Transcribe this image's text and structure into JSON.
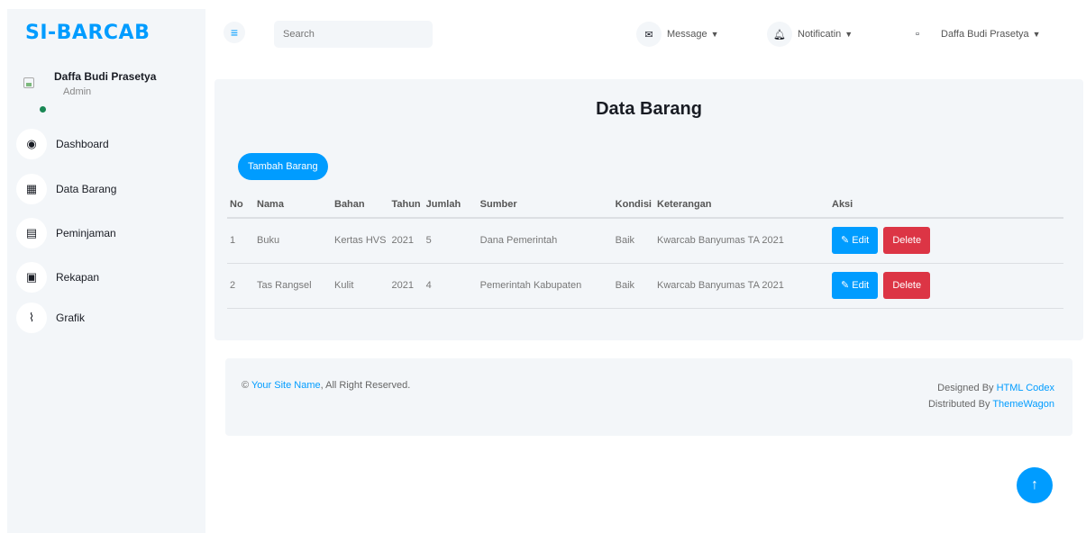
{
  "sidebar": {
    "brand": "SI-BARCAB",
    "profile": {
      "name": "Daffa Budi Prasetya",
      "role": "Admin"
    },
    "items": [
      {
        "label": "Dashboard",
        "icon": "tachometer-icon"
      },
      {
        "label": "Data Barang",
        "icon": "grid-icon"
      },
      {
        "label": "Peminjaman",
        "icon": "id-card-icon"
      },
      {
        "label": "Rekapan",
        "icon": "table-icon"
      },
      {
        "label": "Grafik",
        "icon": "chart-line-icon"
      }
    ]
  },
  "topbar": {
    "search_placeholder": "Search",
    "message_label": "Message",
    "notification_label": "Notificatin",
    "user_name": "Daffa Budi Prasetya"
  },
  "main": {
    "title": "Data Barang",
    "add_button": "Tambah Barang",
    "columns": [
      "No",
      "Nama",
      "Bahan",
      "Tahun",
      "Jumlah",
      "Sumber",
      "Kondisi",
      "Keterangan",
      "Aksi"
    ],
    "rows": [
      {
        "no": "1",
        "nama": "Buku",
        "bahan": "Kertas HVS",
        "tahun": "2021",
        "jumlah": "5",
        "sumber": "Dana Pemerintah",
        "kondisi": "Baik",
        "keterangan": "Kwarcab Banyumas TA 2021"
      },
      {
        "no": "2",
        "nama": "Tas Rangsel",
        "bahan": "Kulit",
        "tahun": "2021",
        "jumlah": "4",
        "sumber": "Pemerintah Kabupaten",
        "kondisi": "Baik",
        "keterangan": "Kwarcab Banyumas TA 2021"
      }
    ],
    "edit_label": "Edit",
    "delete_label": "Delete"
  },
  "footer": {
    "copyright_symbol": "©",
    "site_name": "Your Site Name",
    "rights": ", All Right Reserved.",
    "designed_by": "Designed By",
    "designer": "HTML Codex",
    "distributed_by": "Distributed By",
    "distributor": "ThemeWagon"
  },
  "colors": {
    "accent": "#009cff",
    "danger": "#dc3545",
    "panel": "#f3f6f9"
  }
}
